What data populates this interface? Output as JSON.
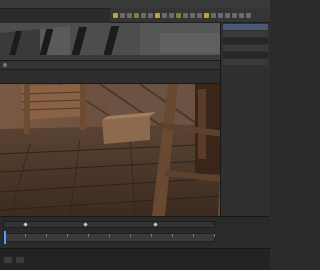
{
  "menubar": {
    "items": []
  },
  "toolbar": {
    "tool_count": 22
  },
  "colors": {
    "accent": "#c9a22a",
    "selection": "#4a5a72",
    "playhead": "#4aa3ff",
    "background": "#2b2b2b"
  },
  "icons": {
    "tool": "tool-icon",
    "key": "keyframe-icon"
  },
  "right_panel": {
    "rows": [
      {
        "label": ""
      },
      {
        "label": ""
      },
      {
        "label": ""
      },
      {
        "label": ""
      },
      {
        "label": ""
      },
      {
        "label": ""
      }
    ]
  },
  "timeline": {
    "labels": []
  },
  "status": {
    "text": ""
  }
}
